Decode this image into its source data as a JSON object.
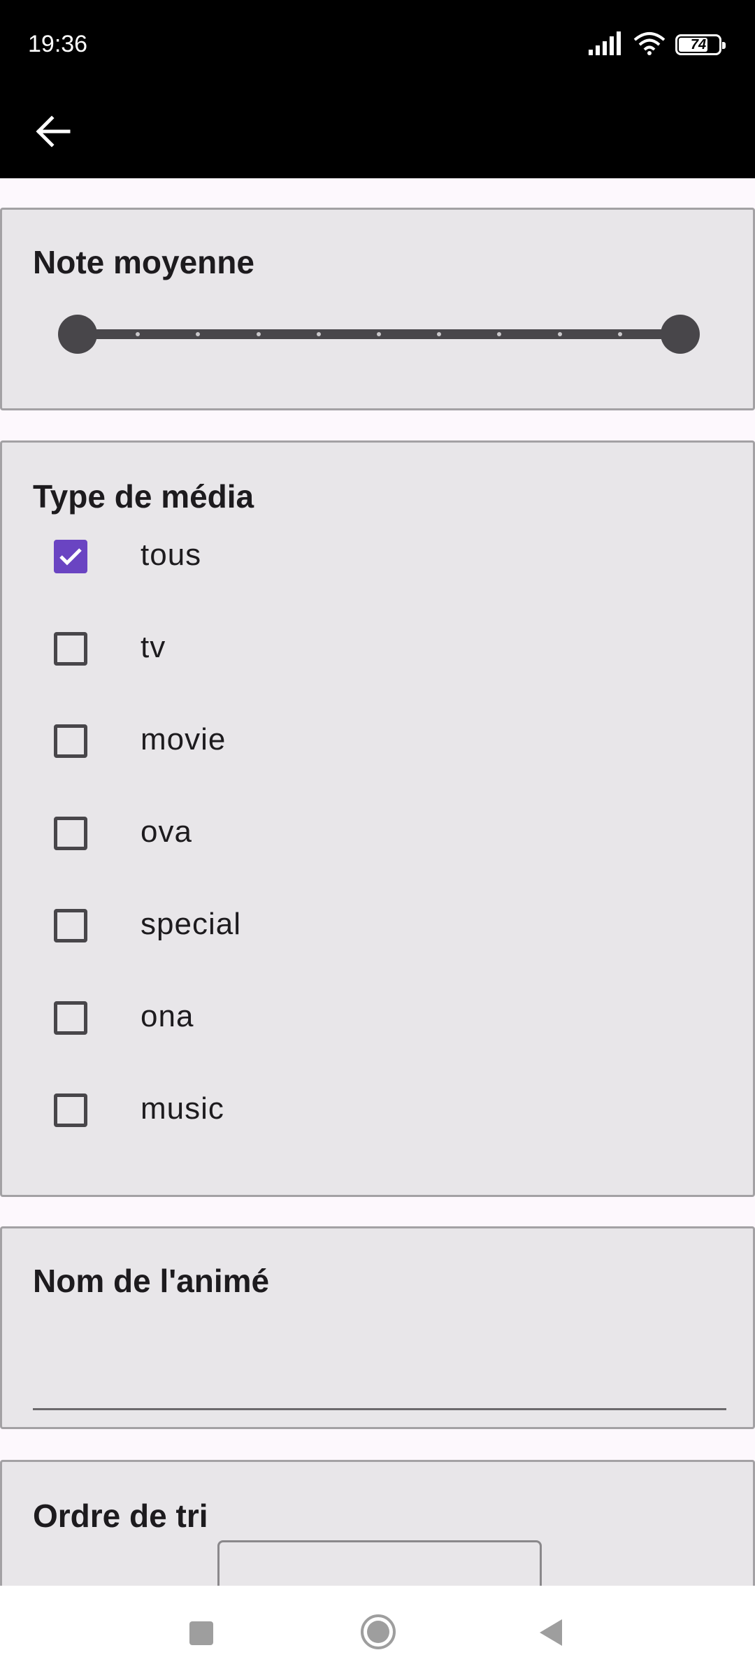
{
  "status_bar": {
    "time": "19:36",
    "battery_level": "74",
    "icons": [
      "signal-icon",
      "wifi-icon",
      "battery-icon"
    ]
  },
  "app_bar": {
    "back_icon": "arrow-left-icon"
  },
  "rating_section": {
    "title": "Note moyenne",
    "range_min_fraction": 0,
    "range_max_fraction": 1
  },
  "media_section": {
    "title": "Type de média",
    "options": [
      {
        "label": "tous",
        "checked": true
      },
      {
        "label": "tv",
        "checked": false
      },
      {
        "label": "movie",
        "checked": false
      },
      {
        "label": "ova",
        "checked": false
      },
      {
        "label": "special",
        "checked": false
      },
      {
        "label": "ona",
        "checked": false
      },
      {
        "label": "music",
        "checked": false
      }
    ]
  },
  "name_section": {
    "title": "Nom de l'animé",
    "value": ""
  },
  "sort_section": {
    "title": "Ordre de tri",
    "selected": ""
  },
  "colors": {
    "accent": "#6a44c2",
    "card_background": "#e8e6e9",
    "page_background": "#fdf8fd",
    "bar_background": "#000000"
  },
  "nav_bar": {
    "icons": [
      "square-icon",
      "circle-home-icon",
      "triangle-back-icon"
    ]
  }
}
